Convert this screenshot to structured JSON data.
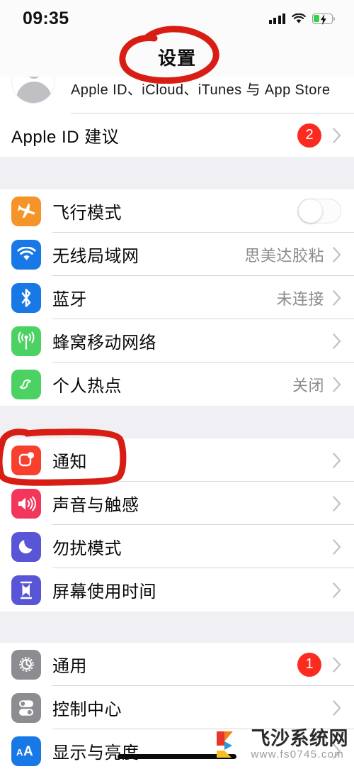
{
  "status_bar": {
    "time": "09:35",
    "signal_icon": "cellular-signal-icon",
    "wifi_icon": "wifi-icon",
    "battery_icon": "battery-charging-icon",
    "battery_level_percent": 32,
    "battery_charging": true
  },
  "nav": {
    "title": "设置"
  },
  "account": {
    "subtitle": "Apple ID、iCloud、iTunes 与 App Store",
    "avatar_icon": "person-avatar-icon"
  },
  "suggestion": {
    "label": "Apple ID 建议",
    "badge": "2"
  },
  "sections": [
    {
      "name": "connectivity",
      "rows": [
        {
          "label": "飞行模式",
          "icon": "airplane-icon",
          "icon_color": "#F49429",
          "accessory": "toggle",
          "toggle_on": false
        },
        {
          "label": "无线局域网",
          "icon": "wifi-icon",
          "icon_color": "#1878E5",
          "accessory": "value",
          "value": "思美达胶粘"
        },
        {
          "label": "蓝牙",
          "icon": "bluetooth-icon",
          "icon_color": "#1878E5",
          "accessory": "value",
          "value": "未连接"
        },
        {
          "label": "蜂窝移动网络",
          "icon": "cellular-antenna-icon",
          "icon_color": "#4CD263",
          "accessory": "chevron",
          "value": ""
        },
        {
          "label": "个人热点",
          "icon": "personal-hotspot-icon",
          "icon_color": "#4CD263",
          "accessory": "value",
          "value": "关闭"
        }
      ]
    },
    {
      "name": "alerts",
      "rows": [
        {
          "label": "通知",
          "icon": "notifications-icon",
          "icon_color": "#F8402F",
          "accessory": "chevron",
          "value": ""
        },
        {
          "label": "声音与触感",
          "icon": "sounds-haptics-icon",
          "icon_color": "#F3375C",
          "accessory": "chevron",
          "value": ""
        },
        {
          "label": "勿扰模式",
          "icon": "do-not-disturb-moon-icon",
          "icon_color": "#5855D6",
          "accessory": "chevron",
          "value": ""
        },
        {
          "label": "屏幕使用时间",
          "icon": "screen-time-hourglass-icon",
          "icon_color": "#5855D6",
          "accessory": "chevron",
          "value": ""
        }
      ]
    },
    {
      "name": "system",
      "rows": [
        {
          "label": "通用",
          "icon": "gear-icon",
          "icon_color": "#8C8C91",
          "accessory": "badge",
          "badge": "1"
        },
        {
          "label": "控制中心",
          "icon": "control-center-toggles-icon",
          "icon_color": "#8C8C91",
          "accessory": "chevron",
          "value": ""
        },
        {
          "label": "显示与亮度",
          "icon": "display-brightness-aa-icon",
          "icon_color": "#1878E5",
          "accessory": "chevron",
          "value": ""
        }
      ]
    }
  ],
  "annotations": [
    {
      "name": "title-circle-annotation",
      "shape": "hand-drawn-ellipse",
      "color": "#D81E14",
      "targets": "设置"
    },
    {
      "name": "notifications-box-annotation",
      "shape": "hand-drawn-rounded-rect",
      "color": "#D81E14",
      "targets": "通知"
    }
  ],
  "watermark": {
    "site_name": "飞沙系统网",
    "url": "www.fs0745.com",
    "logo_icon": "fs-mountain-logo-icon"
  },
  "home_indicator": {
    "name": "home-indicator"
  },
  "colors": {
    "badge_red": "#FB2B1F",
    "annotation_red": "#D81E14",
    "list_background": "#EFEFF4",
    "row_background": "#FFFFFF",
    "separator": "#D6D6DA",
    "secondary_text": "#8B8B90"
  }
}
